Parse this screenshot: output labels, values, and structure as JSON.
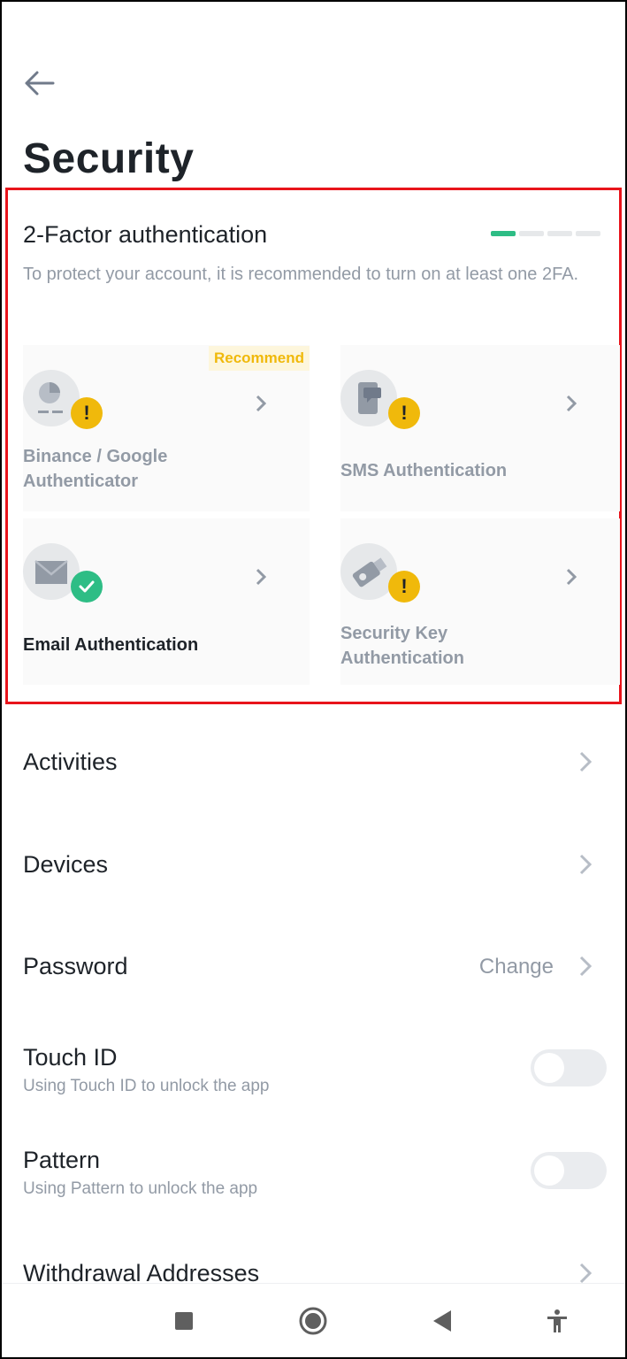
{
  "header": {
    "title": "Security"
  },
  "twofa": {
    "title": "2-Factor authentication",
    "description": "To protect your account, it is recommended to turn on at least one 2FA.",
    "strength_level": 1,
    "strength_total": 4,
    "colors": {
      "active": "#2ebd85",
      "inactive": "#e6e8ea",
      "warning": "#f0b90b",
      "highlight": "#e8141b"
    },
    "cards": {
      "google": {
        "line1": "Binance / Google",
        "line2": "Authenticator",
        "badge": "Recommend",
        "status": "warning",
        "icon": "authenticator-icon"
      },
      "sms": {
        "label": "SMS Authentication",
        "status": "warning",
        "icon": "phone-message-icon"
      },
      "email": {
        "label": "Email Authentication",
        "status": "enabled",
        "icon": "envelope-icon"
      },
      "key": {
        "line1": "Security Key",
        "line2": "Authentication",
        "status": "warning",
        "icon": "usb-key-icon"
      }
    }
  },
  "menu": {
    "activities": {
      "label": "Activities"
    },
    "devices": {
      "label": "Devices"
    },
    "password": {
      "label": "Password",
      "action": "Change"
    },
    "touch_id": {
      "label": "Touch ID",
      "subtitle": "Using Touch ID to unlock the app",
      "enabled": false
    },
    "pattern": {
      "label": "Pattern",
      "subtitle": "Using Pattern to unlock the app",
      "enabled": false
    },
    "withdrawal": {
      "label": "Withdrawal Addresses"
    }
  },
  "nav": {
    "icons": [
      "recent-apps-icon",
      "home-icon",
      "back-icon",
      "accessibility-icon"
    ]
  }
}
